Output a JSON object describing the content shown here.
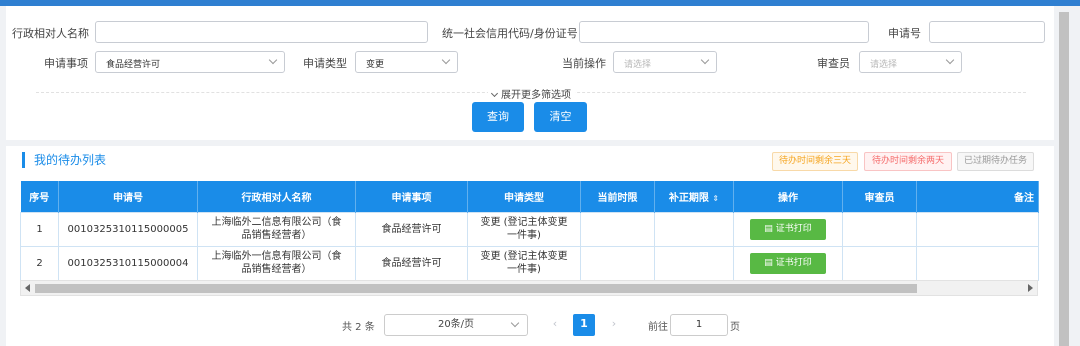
{
  "filters": {
    "name_label": "行政相对人名称",
    "credit_code_label": "统一社会信用代码/身份证号",
    "app_no_label": "申请号",
    "matter_label": "申请事项",
    "matter_value": "食品经营许可",
    "type_label": "申请类型",
    "type_value": "变更",
    "op_label": "当前操作",
    "op_placeholder": "请选择",
    "reviewer_label": "审查员",
    "reviewer_placeholder": "请选择",
    "expand_label": "展开更多筛选项",
    "query_button": "查询",
    "clear_button": "清空"
  },
  "list": {
    "title": "我的待办列表",
    "legends": [
      "待办时间剩余三天",
      "待办时间剩余两天",
      "已过期待办任务"
    ],
    "legend_colors": [
      "#f5a623",
      "#f56c6c",
      "#999999"
    ],
    "columns": [
      "序号",
      "申请号",
      "行政相对人名称",
      "申请事项",
      "申请类型",
      "当前时限",
      "补正期限",
      "操作",
      "审查员",
      "备注"
    ],
    "rows": [
      {
        "index": "1",
        "app_no": "0010325310115000005",
        "name": "上海临外二信息有限公司（食品销售经营者）",
        "matter": "食品经营许可",
        "type": "变更 (登记主体变更一件事)",
        "limit": "",
        "correction": "",
        "action": "证书打印",
        "reviewer": "",
        "note": ""
      },
      {
        "index": "2",
        "app_no": "0010325310115000004",
        "name": "上海临外一信息有限公司（食品销售经营者）",
        "matter": "食品经营许可",
        "type": "变更 (登记主体变更一件事)",
        "limit": "",
        "correction": "",
        "action": "证书打印",
        "reviewer": "",
        "note": ""
      }
    ]
  },
  "pagination": {
    "total": "共 2 条",
    "page_size": "20条/页",
    "current_page": "1",
    "goto_label": "前往",
    "goto_value": "1",
    "page_suffix": "页"
  },
  "colors": {
    "primary": "#1a8ce8",
    "print_button": "#58b944"
  }
}
